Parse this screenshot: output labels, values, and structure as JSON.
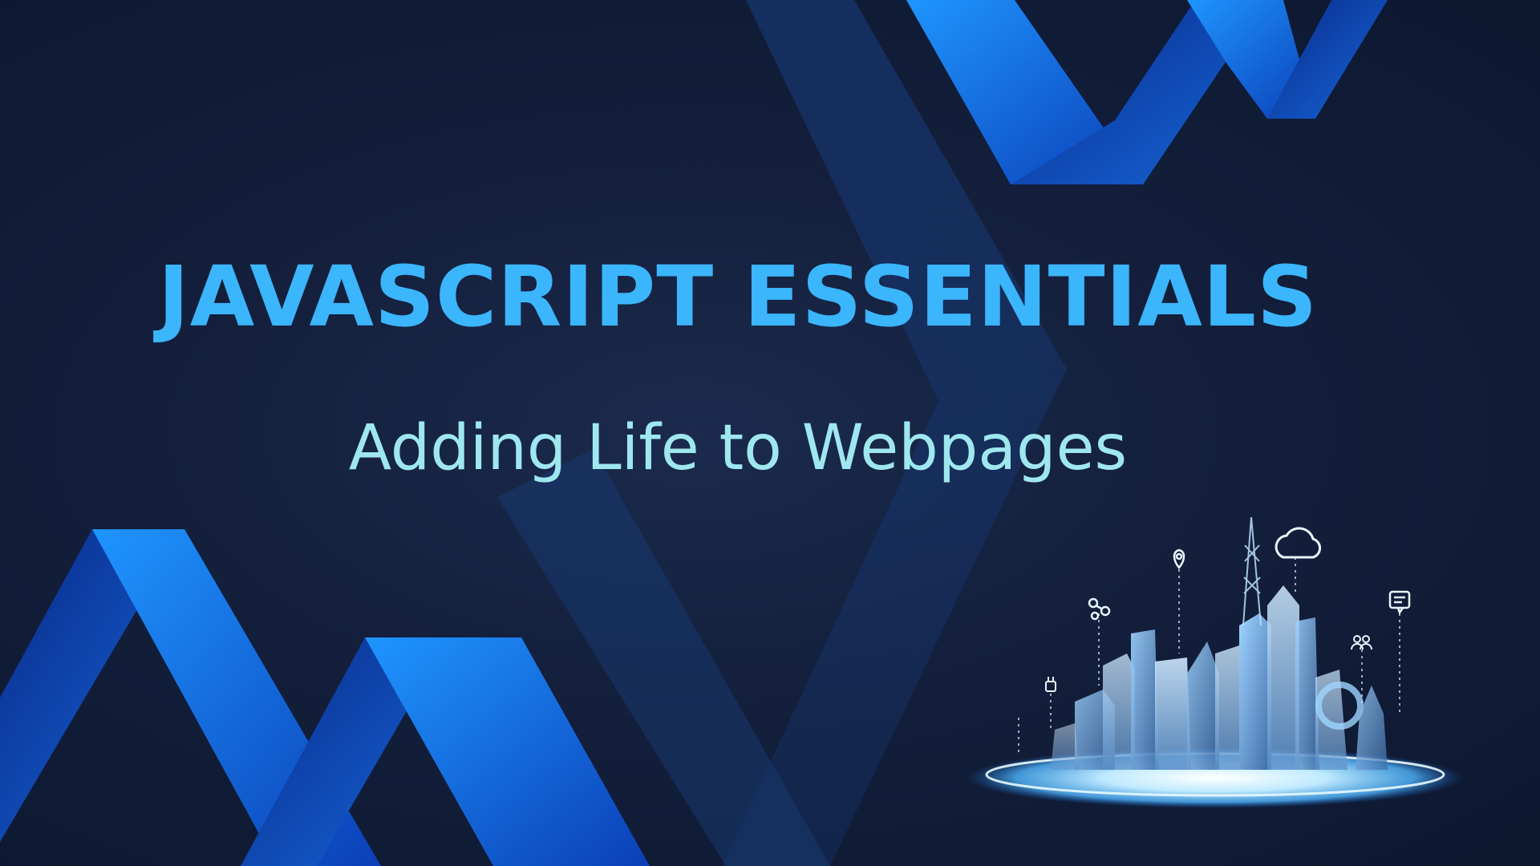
{
  "slide": {
    "title": "JAVASCRIPT ESSENTIALS",
    "subtitle": "Adding Life to Webpages"
  },
  "colors": {
    "background": "#131f3b",
    "title": "#3bb5fb",
    "subtitle": "#9fe7ef",
    "ribbon_light": "#1e8cf0",
    "ribbon_dark": "#0b2c8c",
    "ribbon_muted": "#1a3d78"
  },
  "illustration": {
    "subject": "smart-city-hologram",
    "icons": [
      "cloud-icon",
      "location-pin-icon",
      "network-nodes-icon",
      "chat-bubble-icon",
      "users-icon",
      "plug-icon"
    ]
  }
}
